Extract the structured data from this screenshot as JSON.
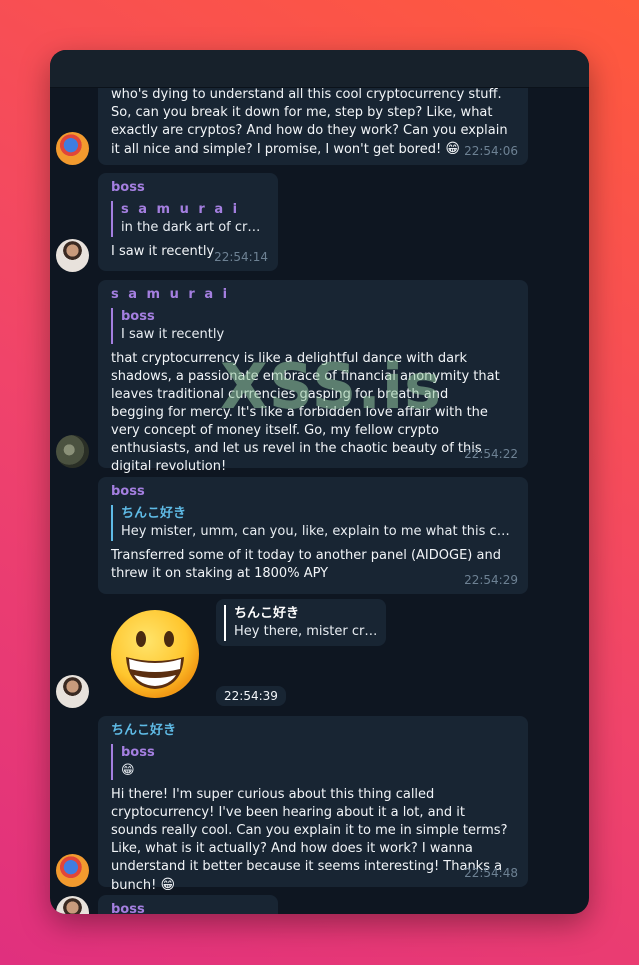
{
  "watermark": "XSS.is",
  "messages": [
    {
      "id": "m1",
      "text": "who's dying to understand all this cool cryptocurrency stuff. So, can you break it down for me, step by step? Like, what exactly are cryptos? And how do they work? Can you explain it all nice and simple? I promise, I won't get bored!",
      "emoji": "😁",
      "time": "22:54:06"
    },
    {
      "id": "m2",
      "sender": "boss",
      "reply_name": "s a m u r a i",
      "reply_text": "in the dark art of crypt...",
      "text": "I saw it recently",
      "time": "22:54:14"
    },
    {
      "id": "m3",
      "sender": "s a m u r a i",
      "reply_name": "boss",
      "reply_text": "I saw it recently",
      "text": "that cryptocurrency is like a delightful dance with dark shadows, a passionate embrace of financial anonymity that leaves traditional currencies gasping for breath and begging for mercy. It's like a forbidden love affair with the very concept of money itself. Go, my fellow crypto enthusiasts, and let us revel in the chaotic beauty of this digital revolution!",
      "time": "22:54:22"
    },
    {
      "id": "m4",
      "sender": "boss",
      "reply_name": "ちんこ好き",
      "reply_text": "Hey mister, umm, can you, like, explain to me what this crying-to...",
      "text": "Transferred some of it today to another panel (AIDOGE) and threw it on staking at 1800% APY",
      "time": "22:54:29"
    },
    {
      "id": "m5",
      "sticker": "😁",
      "reply_name": "ちんこ好き",
      "reply_text": "Hey there, mister cryp...",
      "time": "22:54:39"
    },
    {
      "id": "m6",
      "sender": "ちんこ好き",
      "reply_name": "boss",
      "reply_text": "😁",
      "text": "Hi there! I'm super curious about this thing called cryptocurrency! I've been hearing about it a lot, and it sounds really cool. Can you explain it to me in simple terms? Like, what is it actually? And how does it work? I wanna understand it better because it seems interesting! Thanks a bunch!",
      "emoji": "😁",
      "time": "22:54:48"
    },
    {
      "id": "m7",
      "sender": "boss"
    }
  ]
}
